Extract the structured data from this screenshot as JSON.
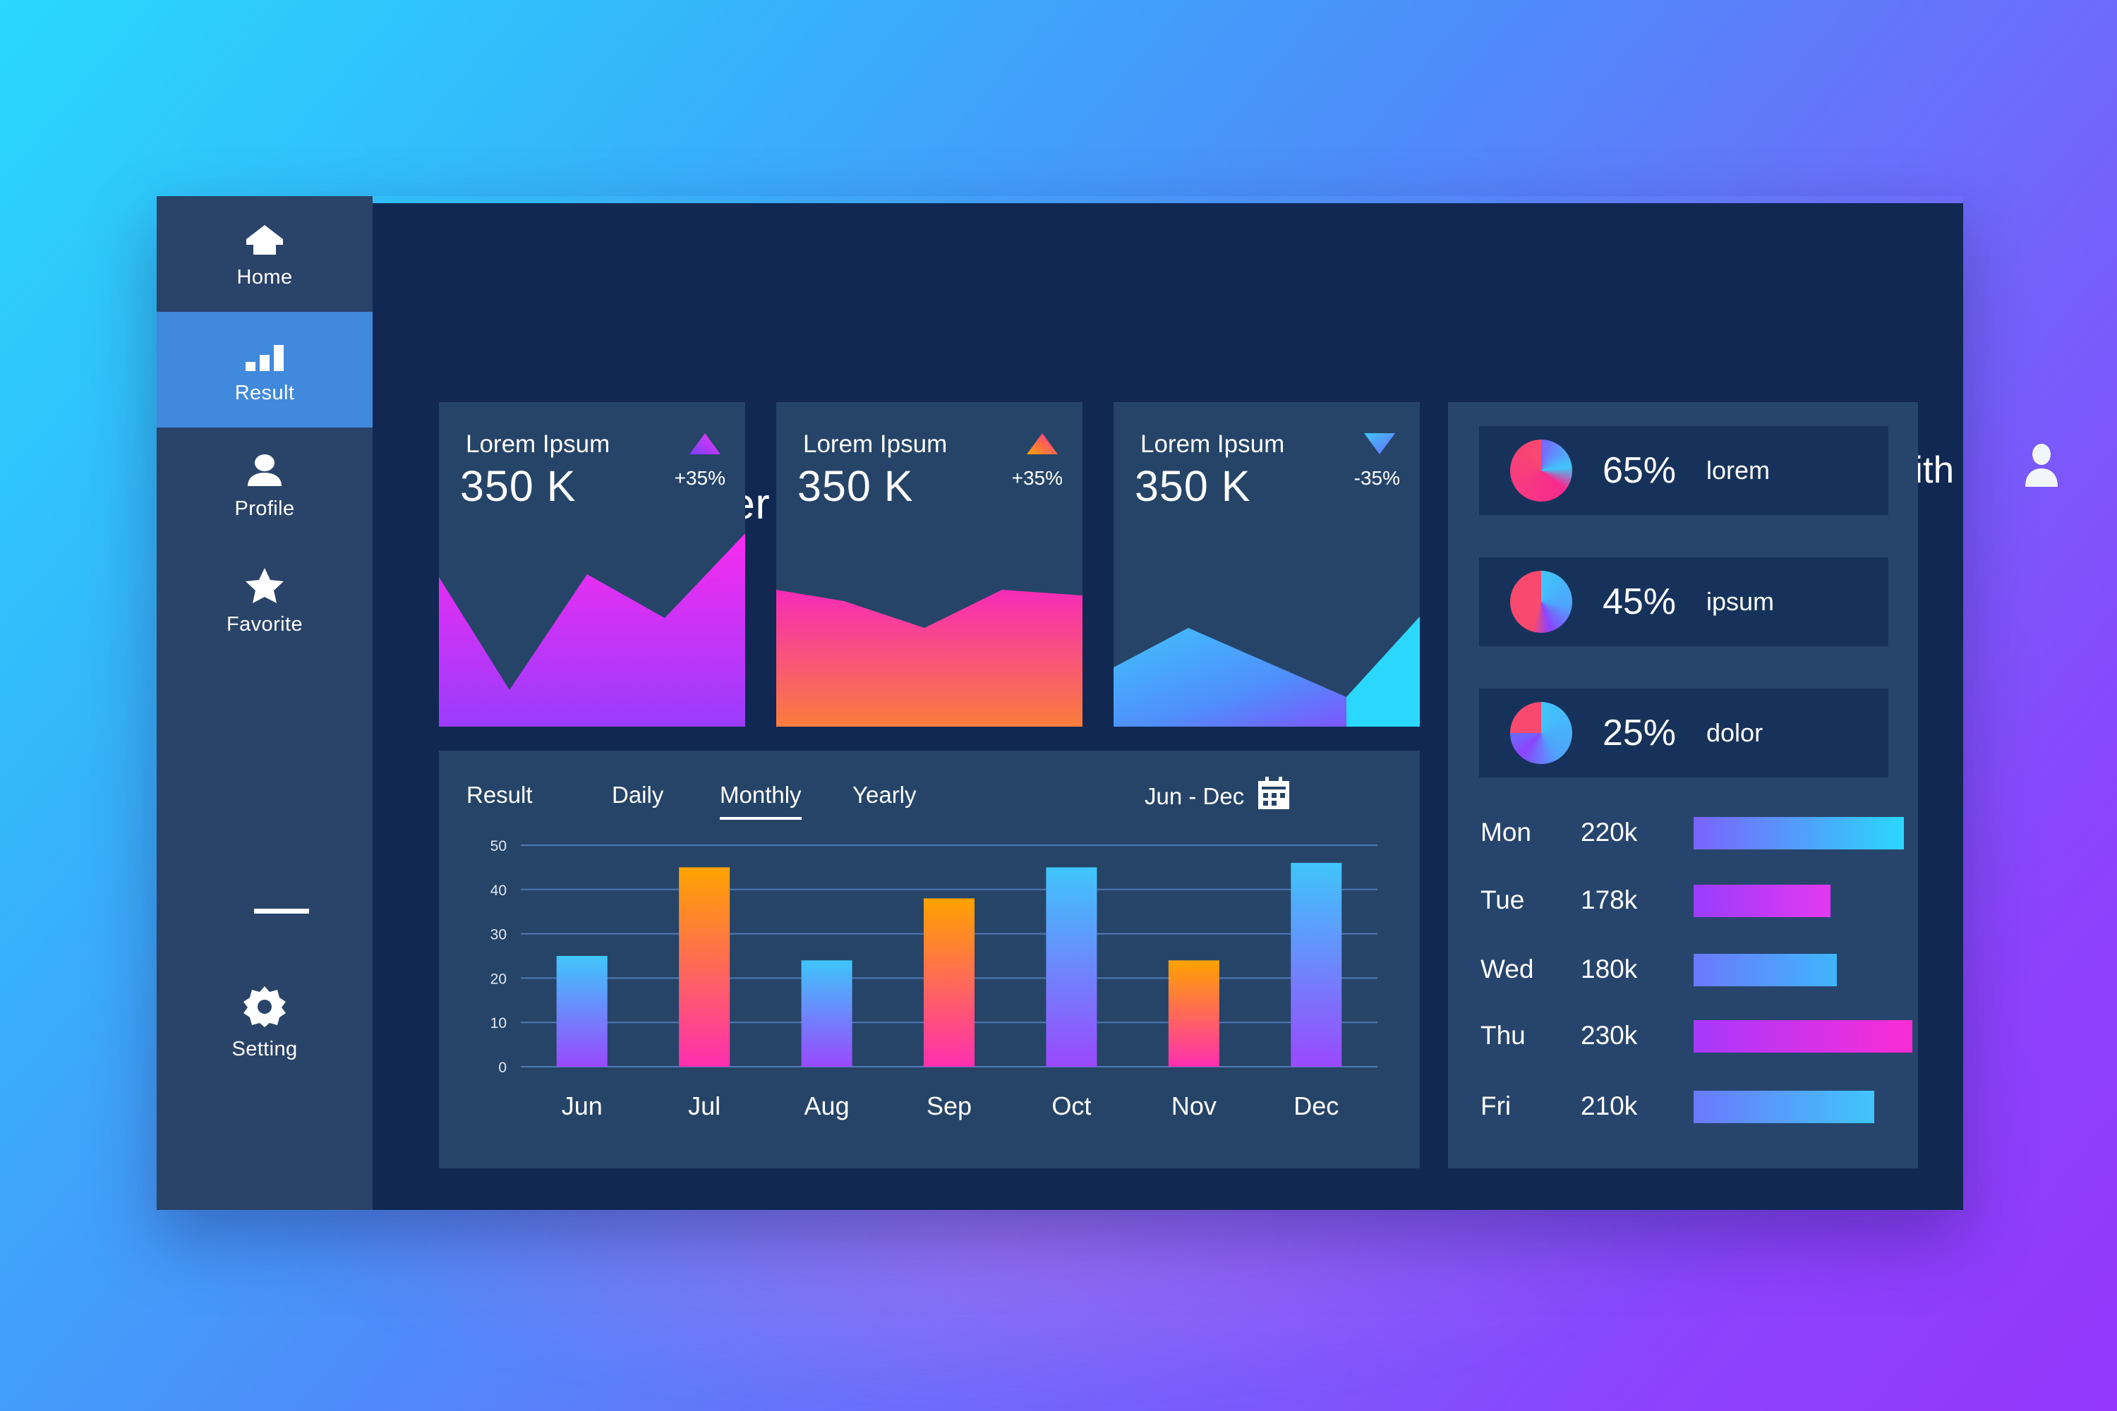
{
  "theme": {
    "bg_gradient_start": "#29d8fc",
    "bg_gradient_end": "#8c43fc",
    "panel_bg": "#102852",
    "sidebar_bg": "#2a4369",
    "card_bg": "#264468",
    "right_panel_bg": "#27456c",
    "pie_card_bg": "#17325a",
    "sidebar_active": "#4189dc",
    "text": "#ffffff"
  },
  "sidebar": {
    "items": [
      {
        "label": "Home",
        "icon": "home-icon",
        "active": false
      },
      {
        "label": "Result",
        "icon": "bar-chart-icon",
        "active": true
      },
      {
        "label": "Profile",
        "icon": "user-icon",
        "active": false
      },
      {
        "label": "Favorite",
        "icon": "star-icon",
        "active": false
      },
      {
        "label": "Setting",
        "icon": "gear-icon",
        "active": false
      }
    ]
  },
  "header": {
    "title": "Dashboard User",
    "search": {
      "value": "",
      "placeholder": "",
      "icon": "search-icon"
    },
    "user": {
      "name": "John Smith",
      "avatar_icon": "user-avatar-icon"
    }
  },
  "stat_cards": [
    {
      "title": "Lorem Ipsum",
      "value": "350 K",
      "delta": "+35%",
      "direction": "up",
      "accent": "#ef38f0"
    },
    {
      "title": "Lorem Ipsum",
      "value": "350 K",
      "delta": "+35%",
      "direction": "up",
      "accent": "#fa7d3c"
    },
    {
      "title": "Lorem Ipsum",
      "value": "350 K",
      "delta": "-35%",
      "direction": "down",
      "accent": "#3fc6fb"
    }
  ],
  "chart_panel": {
    "tabs": [
      {
        "label": "Result",
        "active": false
      },
      {
        "label": "Daily",
        "active": false
      },
      {
        "label": "Monthly",
        "active": true
      },
      {
        "label": "Yearly",
        "active": false
      }
    ],
    "range_label": "Jun - Dec",
    "calendar_icon": "calendar-icon"
  },
  "chart_data": {
    "type": "bar",
    "title": "",
    "xlabel": "",
    "ylabel": "",
    "categories": [
      "Jun",
      "Jul",
      "Aug",
      "Sep",
      "Oct",
      "Nov",
      "Dec"
    ],
    "values": [
      25,
      45,
      24,
      38,
      45,
      24,
      46
    ],
    "ylim": [
      0,
      50
    ],
    "yticks": [
      0,
      10,
      20,
      30,
      40,
      50
    ],
    "ytick_labels": [
      "0",
      "10",
      "20",
      "30",
      "40",
      "50"
    ],
    "grid": true,
    "legend": "none",
    "bar_gradients": [
      [
        "#3fc6fb",
        "#9a49fd"
      ],
      [
        "#ffa300",
        "#ff2fb0"
      ],
      [
        "#3fc6fb",
        "#9a49fd"
      ],
      [
        "#ffa300",
        "#ff2fb0"
      ],
      [
        "#3fc6fb",
        "#9a49fd"
      ],
      [
        "#ffa300",
        "#ff2fb0"
      ],
      [
        "#3fc6fb",
        "#9a49fd"
      ]
    ]
  },
  "pie_stats": [
    {
      "percent_label": "65%",
      "value": 65,
      "label": "lorem"
    },
    {
      "percent_label": "45%",
      "value": 45,
      "label": "ipsum"
    },
    {
      "percent_label": "25%",
      "value": 25,
      "label": "dolor"
    }
  ],
  "weekly": {
    "rows": [
      {
        "day": "Mon",
        "value": "220k",
        "width_pct": 100,
        "color_a": "#7b63fd",
        "color_b": "#29d8fc"
      },
      {
        "day": "Tue",
        "value": "178k",
        "width_pct": 65,
        "color_a": "#9a3cfd",
        "color_b": "#e339f0"
      },
      {
        "day": "Wed",
        "value": "180k",
        "width_pct": 68,
        "color_a": "#6b79fd",
        "color_b": "#3fb5fb"
      },
      {
        "day": "Thu",
        "value": "230k",
        "width_pct": 104,
        "color_a": "#a738fd",
        "color_b": "#fa2cd4"
      },
      {
        "day": "Fri",
        "value": "210k",
        "width_pct": 86,
        "color_a": "#6b79fd",
        "color_b": "#3fc6fb"
      }
    ]
  }
}
